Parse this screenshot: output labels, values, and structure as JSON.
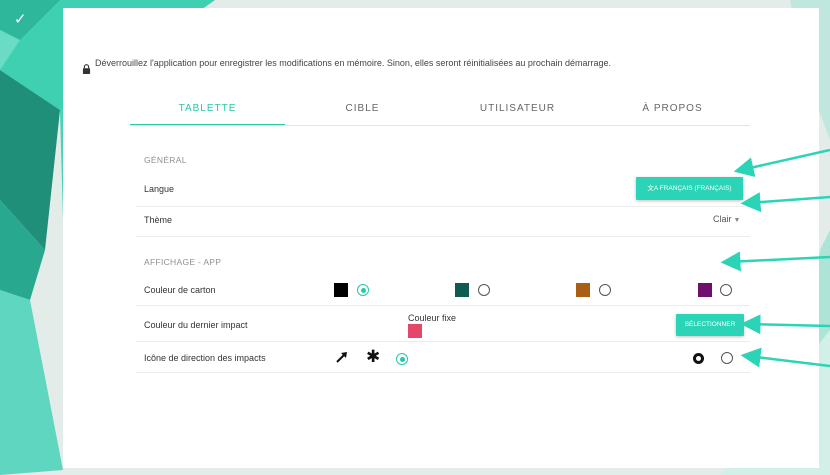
{
  "colors": {
    "accent": "#2bd4b7",
    "annotation_arrow": "#2bd4b7"
  },
  "notice": {
    "icon": "lock-icon",
    "text": "Déverrouillez l'application pour enregistrer les modifications en mémoire. Sinon, elles seront réinitialisées au prochain démarrage."
  },
  "tabs": [
    {
      "label": "TABLETTE",
      "active": true
    },
    {
      "label": "CIBLE",
      "active": false
    },
    {
      "label": "UTILISATEUR",
      "active": false
    },
    {
      "label": "À PROPOS",
      "active": false
    }
  ],
  "general": {
    "header": "GÉNÉRAL",
    "language_label": "Langue",
    "language_button": "FRANÇAIS (FRANÇAIS)",
    "language_icon": "translate-icon",
    "theme_label": "Thème",
    "theme_value": "Clair"
  },
  "display": {
    "header": "AFFICHAGE - APP",
    "card_color_label": "Couleur de carton",
    "card_colors": [
      {
        "color": "#000000",
        "selected": true
      },
      {
        "color": "#0f5b52",
        "selected": false
      },
      {
        "color": "#a85f13",
        "selected": false
      },
      {
        "color": "#6e0f6e",
        "selected": false
      }
    ],
    "last_impact_label": "Couleur du dernier impact",
    "fixed_color_label": "Couleur fixe",
    "fixed_color": "#e5476a",
    "select_button": "SÉLECTIONNER",
    "direction_label": "Icône de direction des impacts",
    "direction_options": [
      {
        "icon": "arrow-icon",
        "selected": false
      },
      {
        "icon": "asterisk-icon",
        "selected": true
      },
      {
        "icon": "target-icon",
        "selected": false
      }
    ]
  }
}
